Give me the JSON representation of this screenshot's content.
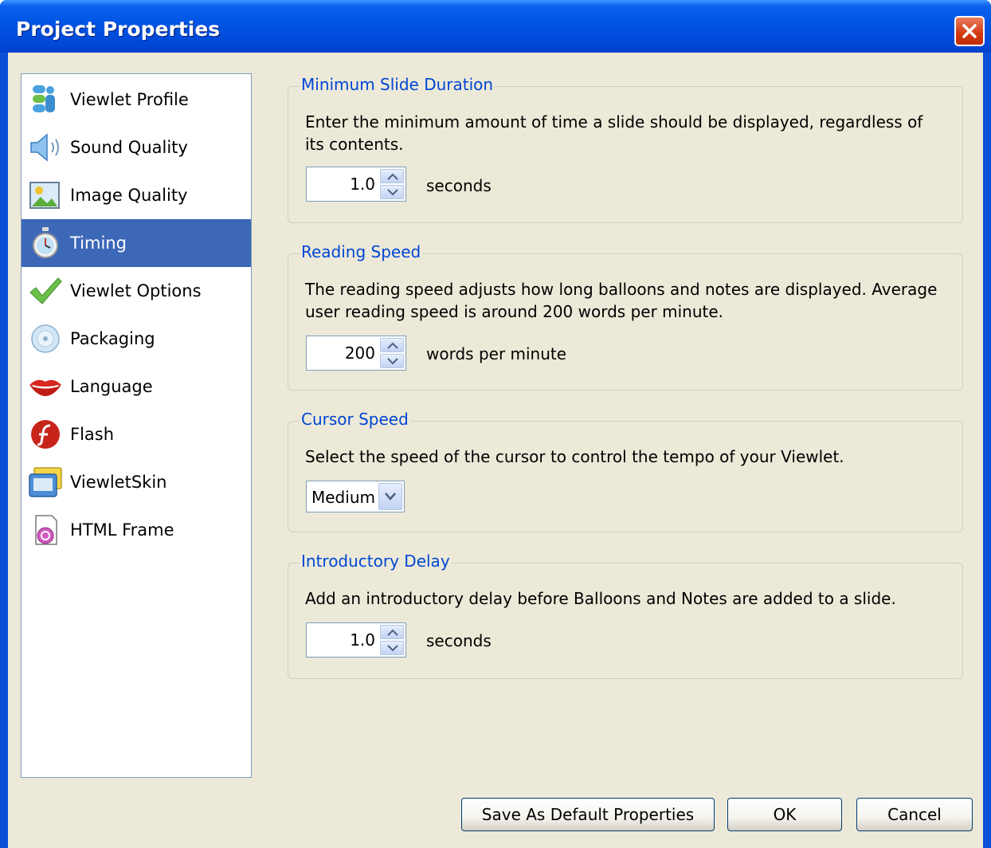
{
  "window": {
    "title": "Project Properties"
  },
  "sidebar": {
    "items": [
      {
        "label": "Viewlet Profile",
        "icon": "profile-icon",
        "selected": false
      },
      {
        "label": "Sound Quality",
        "icon": "speaker-icon",
        "selected": false
      },
      {
        "label": "Image Quality",
        "icon": "image-icon",
        "selected": false
      },
      {
        "label": "Timing",
        "icon": "stopwatch-icon",
        "selected": true
      },
      {
        "label": "Viewlet Options",
        "icon": "checkmark-icon",
        "selected": false
      },
      {
        "label": "Packaging",
        "icon": "disc-icon",
        "selected": false
      },
      {
        "label": "Language",
        "icon": "lips-icon",
        "selected": false
      },
      {
        "label": "Flash",
        "icon": "flash-icon",
        "selected": false
      },
      {
        "label": "ViewletSkin",
        "icon": "skin-icon",
        "selected": false
      },
      {
        "label": "HTML Frame",
        "icon": "html-frame-icon",
        "selected": false
      }
    ]
  },
  "main": {
    "min_slide_duration": {
      "title": "Minimum Slide Duration",
      "description": "Enter the minimum amount of time a slide should be displayed, regardless of its contents.",
      "value": "1.0",
      "unit": "seconds"
    },
    "reading_speed": {
      "title": "Reading Speed",
      "description": "The reading speed adjusts how long balloons and notes are displayed. Average user reading speed is around 200 words per minute.",
      "value": "200",
      "unit": "words per minute"
    },
    "cursor_speed": {
      "title": "Cursor Speed",
      "description": "Select the speed of the cursor to control the tempo of your Viewlet.",
      "selected": "Medium"
    },
    "introductory_delay": {
      "title": "Introductory Delay",
      "description": "Add an introductory delay before Balloons and Notes are added to a slide.",
      "value": "1.0",
      "unit": "seconds"
    }
  },
  "buttons": {
    "save_default": "Save As Default Properties",
    "ok": "OK",
    "cancel": "Cancel"
  },
  "colors": {
    "titlebar": "#0054E3",
    "window_bg": "#ECE9D8",
    "selection": "#3D68B8",
    "group_title": "#0046D5",
    "close": "#D3390F"
  }
}
